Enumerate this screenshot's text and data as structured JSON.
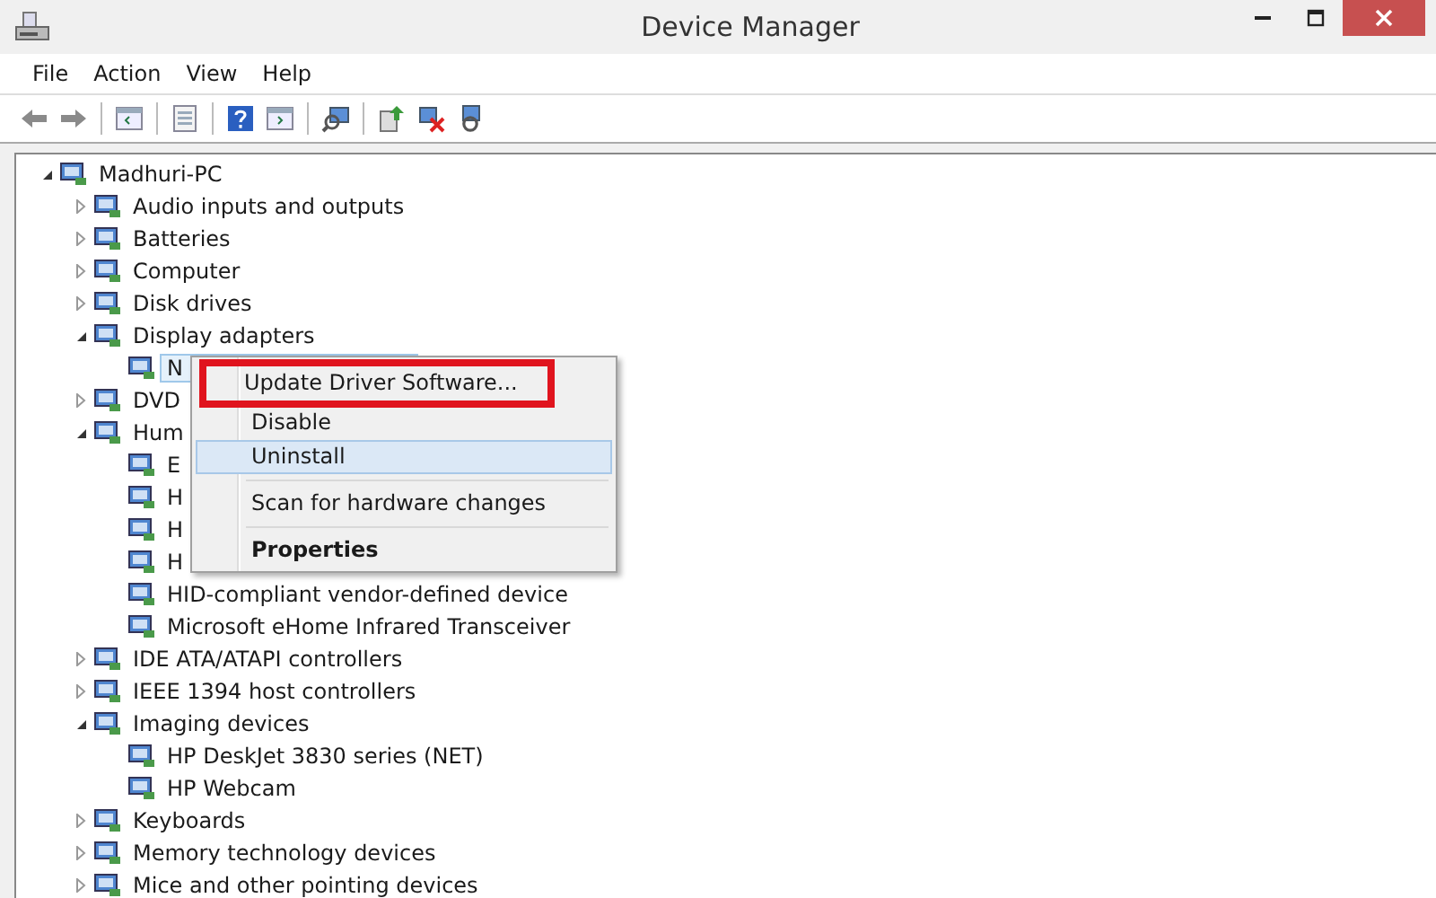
{
  "window": {
    "title": "Device Manager"
  },
  "menu_bar": [
    "File",
    "Action",
    "View",
    "Help"
  ],
  "tree": {
    "label": "Madhuri-PC",
    "expanded": true,
    "selected": false,
    "children": [
      {
        "label": "Audio inputs and outputs",
        "expanded": false,
        "selected": false
      },
      {
        "label": "Batteries",
        "expanded": false,
        "selected": false
      },
      {
        "label": "Computer",
        "expanded": false,
        "selected": false
      },
      {
        "label": "Disk drives",
        "expanded": false,
        "selected": false
      },
      {
        "label": "Display adapters",
        "expanded": true,
        "selected": false,
        "children": [
          {
            "label": "N",
            "selected": true
          }
        ]
      },
      {
        "label": "DVD",
        "expanded": false,
        "selected": false
      },
      {
        "label": "Hum",
        "expanded": true,
        "selected": false,
        "children": [
          {
            "label": "E",
            "selected": false
          },
          {
            "label": "H",
            "selected": false
          },
          {
            "label": "H",
            "selected": false
          },
          {
            "label": "H",
            "selected": false
          },
          {
            "label": "HID-compliant vendor-defined device",
            "selected": false
          },
          {
            "label": "Microsoft eHome Infrared Transceiver",
            "selected": false
          }
        ]
      },
      {
        "label": "IDE ATA/ATAPI controllers",
        "expanded": false,
        "selected": false
      },
      {
        "label": "IEEE 1394 host controllers",
        "expanded": false,
        "selected": false
      },
      {
        "label": "Imaging devices",
        "expanded": true,
        "selected": false,
        "children": [
          {
            "label": "HP DeskJet 3830 series (NET)",
            "selected": false
          },
          {
            "label": "HP Webcam",
            "selected": false
          }
        ]
      },
      {
        "label": "Keyboards",
        "expanded": false,
        "selected": false
      },
      {
        "label": "Memory technology devices",
        "expanded": false,
        "selected": false
      },
      {
        "label": "Mice and other pointing devices",
        "expanded": false,
        "selected": false
      }
    ]
  },
  "context_menu": [
    {
      "kind": "item",
      "label": "Update Driver Software...",
      "selected": false,
      "bold": false,
      "marked": true
    },
    {
      "kind": "item",
      "label": "Disable",
      "selected": false,
      "bold": false,
      "marked": false
    },
    {
      "kind": "item",
      "label": "Uninstall",
      "selected": true,
      "bold": false,
      "marked": false
    },
    {
      "kind": "separator"
    },
    {
      "kind": "item",
      "label": "Scan for hardware changes",
      "selected": false,
      "bold": false,
      "marked": false
    },
    {
      "kind": "separator"
    },
    {
      "kind": "item",
      "label": "Properties",
      "selected": false,
      "bold": true,
      "marked": false
    }
  ]
}
